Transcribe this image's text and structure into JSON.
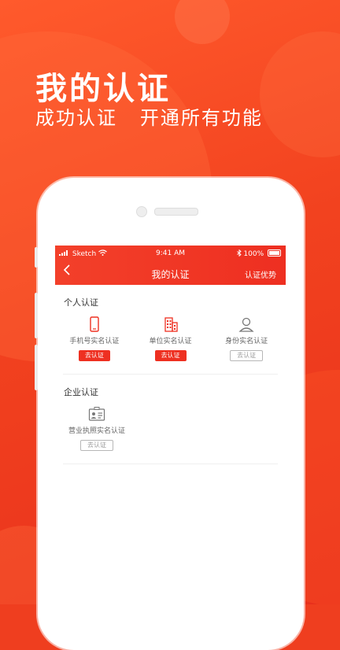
{
  "promo": {
    "headline": "我的认证",
    "subline": "成功认证   开通所有功能"
  },
  "status_bar": {
    "carrier": "Sketch",
    "time": "9:41 AM",
    "battery": "100%"
  },
  "nav": {
    "title": "我的认证",
    "right_link": "认证优势",
    "back_icon": "chevron-left-icon"
  },
  "personal": {
    "title": "个人认证",
    "items": [
      {
        "label": "手机号实名认证",
        "button": "去认证",
        "icon": "mobile-phone-icon",
        "button_style": "red"
      },
      {
        "label": "单位实名认证",
        "button": "去认证",
        "icon": "building-icon",
        "button_style": "red"
      },
      {
        "label": "身份实名认证",
        "button": "去认证",
        "icon": "person-icon",
        "button_style": "gray"
      }
    ]
  },
  "enterprise": {
    "title": "企业认证",
    "items": [
      {
        "label": "营业执照实名认证",
        "button": "去认证",
        "icon": "id-card-icon",
        "button_style": "gray"
      }
    ]
  },
  "colors": {
    "accent": "#ee3021",
    "background": "#f2421f",
    "muted_text": "#666666"
  }
}
